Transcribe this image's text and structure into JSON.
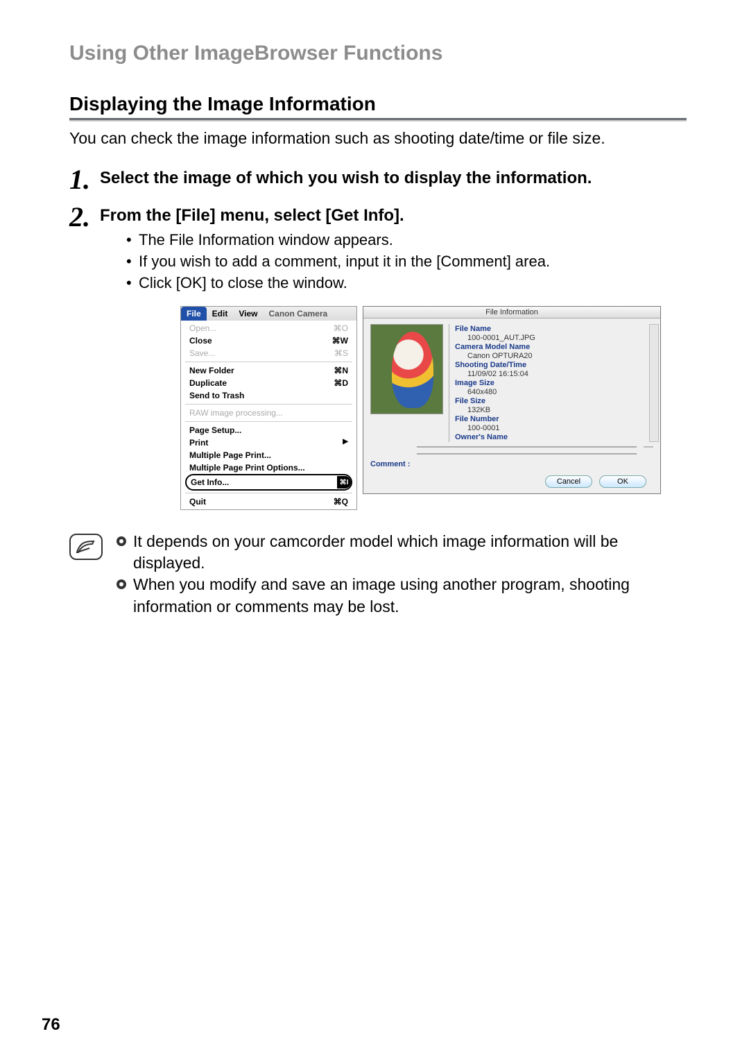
{
  "section_title": "Using Other ImageBrowser Functions",
  "sub_title": "Displaying the Image Information",
  "intro": "You can check the image information such as shooting date/time or file size.",
  "step1_num": "1.",
  "step1_text": "Select the image of which you wish to display the information.",
  "step2_num": "2.",
  "step2_text": "From the [File] menu, select [Get Info].",
  "b1": "The File Information window appears.",
  "b2": "If you wish to add a comment, input it in the [Comment] area.",
  "b3": "Click [OK] to close the window.",
  "menubar": {
    "file": "File",
    "edit": "Edit",
    "view": "View",
    "canon": "Canon Camera",
    "open": "Open...",
    "open_sc": "⌘O",
    "close": "Close",
    "close_sc": "⌘W",
    "save": "Save...",
    "save_sc": "⌘S",
    "newfolder": "New Folder",
    "newfolder_sc": "⌘N",
    "duplicate": "Duplicate",
    "duplicate_sc": "⌘D",
    "sendtrash": "Send to Trash",
    "raw": "RAW image processing...",
    "pagesetup": "Page Setup...",
    "print": "Print",
    "print_arrow": "▶",
    "mpprint": "Multiple Page Print...",
    "mpoptions": "Multiple Page Print Options...",
    "getinfo": "Get Info...",
    "getinfo_sc": "⌘I",
    "quit": "Quit",
    "quit_sc": "⌘Q"
  },
  "dialog": {
    "title": "File Information",
    "fn_label": "File Name",
    "fn_val": "100-0001_AUT.JPG",
    "cm_label": "Camera Model Name",
    "cm_val": "Canon OPTURA20",
    "sd_label": "Shooting Date/Time",
    "sd_val": "11/09/02 16:15:04",
    "is_label": "Image Size",
    "is_val": "640x480",
    "fs_label": "File Size",
    "fs_val": "132KB",
    "fnum_label": "File Number",
    "fnum_val": "100-0001",
    "owner_label": "Owner's Name",
    "comment_label": "Comment :",
    "cancel": "Cancel",
    "ok": "OK"
  },
  "note1": "It depends on your camcorder model which image information will be displayed.",
  "note2a": "When you modify and save an image using another program, shooting information or comments may be lost.",
  "page_num": "76"
}
